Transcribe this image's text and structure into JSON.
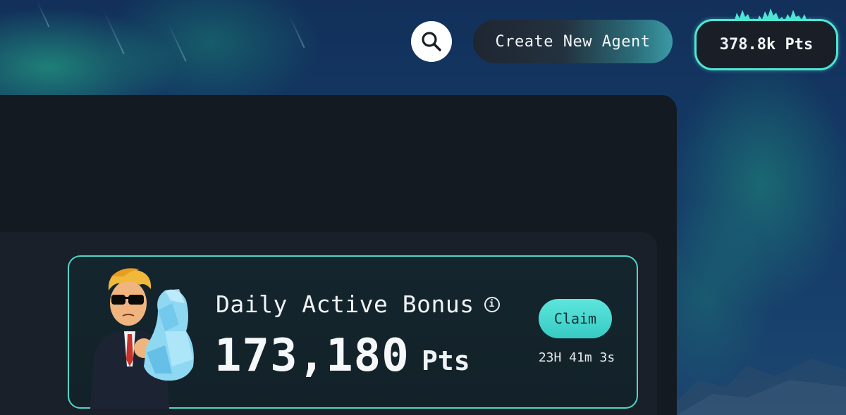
{
  "header": {
    "search_icon": "search-icon",
    "create_agent_label": "Create New Agent",
    "points_balance": "378.8k Pts"
  },
  "bonus_card": {
    "title": "Daily Active Bonus",
    "info_icon": "info-icon",
    "amount": "173,180",
    "unit": "Pts",
    "claim_label": "Claim",
    "countdown": "23H 41m 3s"
  },
  "colors": {
    "accent": "#4fd6c9",
    "panel": "#141a22",
    "card_bg": "#14252d"
  }
}
